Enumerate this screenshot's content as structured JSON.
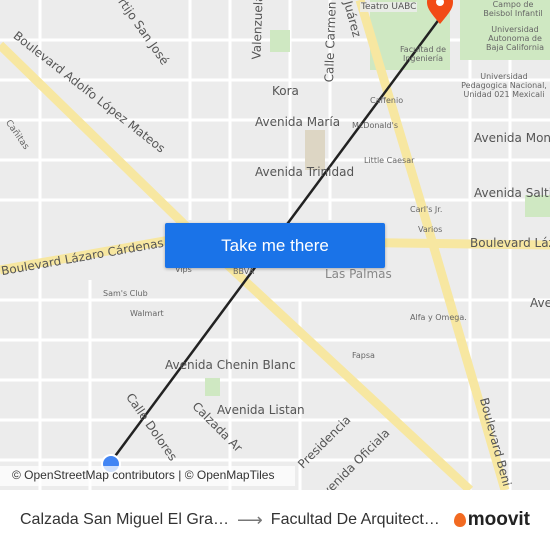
{
  "map": {
    "labels": [
      "Cortijo San José",
      "Boulevard Adolfo López Mateos",
      "Cañitas",
      "Valenzuela",
      "Calle Carmen",
      "Kora",
      "Avenida María",
      "Avenida Trinidad",
      "Boulevard Lázaro Cárdenas",
      "Vips",
      "BBVA",
      "Sam's Club",
      "Walmart",
      "Avenida Chenin Blanc",
      "Avenida Listan",
      "Calle Dolores",
      "Calzada Ar",
      "Presidencia",
      "Avenida Oficiala",
      "Las Palmas",
      "Alfa y Omega.",
      "Fapsa",
      "Boulevard Beni",
      "Teatro UABC",
      "Campo de Beisbol Infantil",
      "Universidad Autonoma de Baja California",
      "Facultad de Ingeniería",
      "Universidad Pedagogica Nacional, Unidad 021 Mexicali",
      "Caffenio",
      "McDonald's",
      "Little Caesar",
      "Carl's Jr.",
      "Varios",
      "Avenida Mon",
      "Avenida Salti",
      "Boulevard Láz",
      "Ave",
      "Juárez"
    ],
    "colors": {
      "route": "#222222",
      "destination": "#f24b16",
      "origin": "#4285f4",
      "road_major": "#f7e7a1"
    }
  },
  "cta": {
    "label": "Take me there"
  },
  "attribution": "© OpenStreetMap contributors | © OpenMapTiles",
  "footer": {
    "origin": "Calzada San Miguel El Gra…",
    "arrow": "⟶",
    "destination": "Facultad De Arquitect…",
    "brand": "moovit"
  }
}
